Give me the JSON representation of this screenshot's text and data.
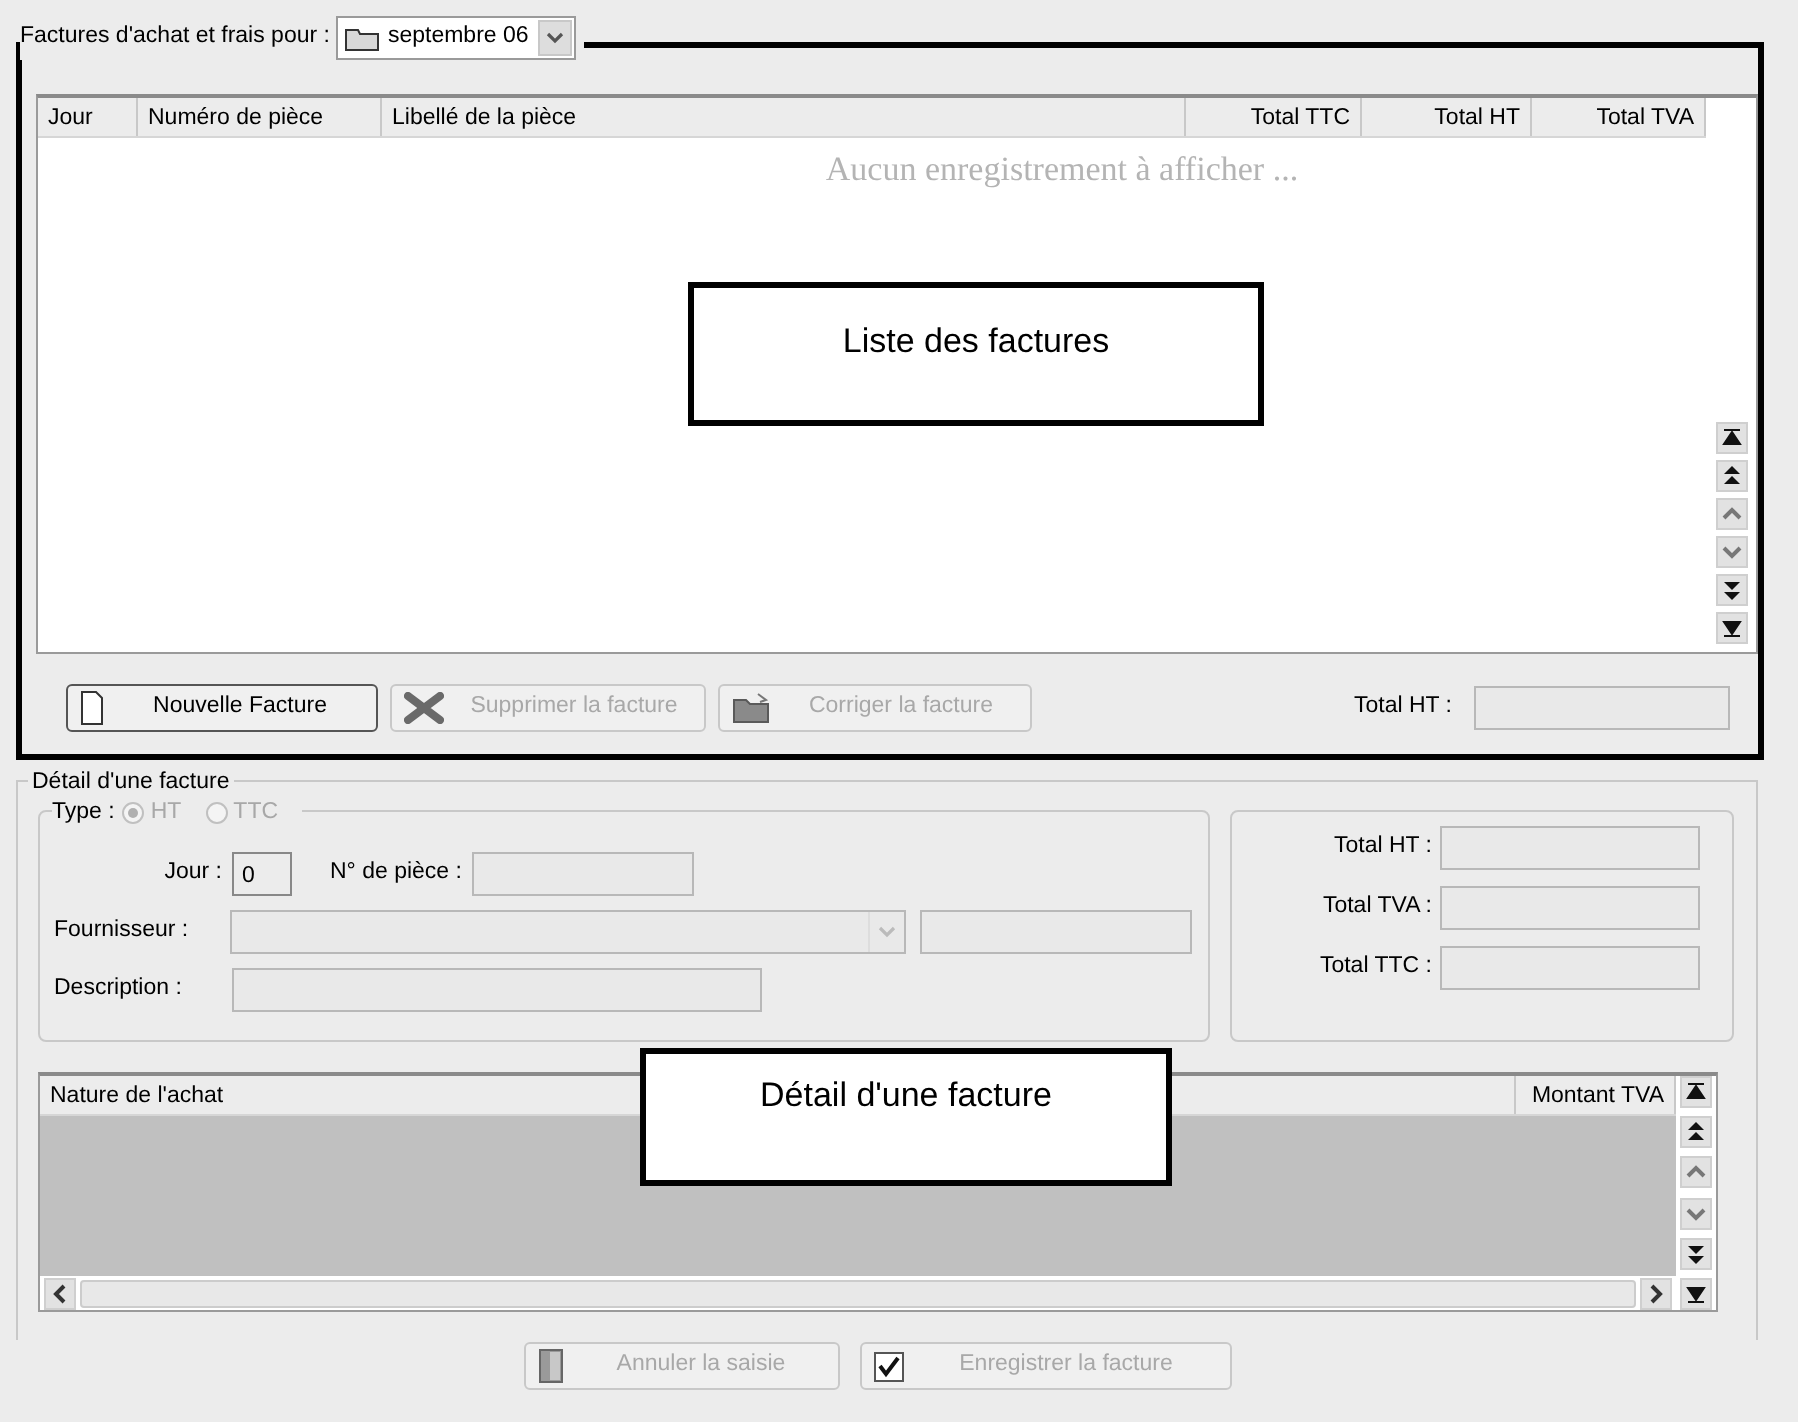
{
  "list_frame": {
    "legend": "Factures d'achat et frais pour :",
    "period": "septembre 06"
  },
  "invoice_list": {
    "columns": [
      {
        "label": "Jour"
      },
      {
        "label": "Numéro de pièce"
      },
      {
        "label": "Libellé de la pièce"
      },
      {
        "label": "Total TTC"
      },
      {
        "label": "Total HT"
      },
      {
        "label": "Total TVA"
      }
    ],
    "empty_message": "Aucun enregistrement à afficher ...",
    "callout": "Liste des factures"
  },
  "list_buttons": [
    {
      "label": "Nouvelle Facture",
      "kind": "new",
      "disabled": false
    },
    {
      "label": "Supprimer la facture",
      "kind": "delete",
      "disabled": true
    },
    {
      "label": "Corriger la facture",
      "kind": "edit",
      "disabled": true
    }
  ],
  "list_total": {
    "label": "Total HT :"
  },
  "detail": {
    "legend": "Détail d'une facture",
    "type_label": "Type :",
    "type_disabled": true,
    "type_options": [
      {
        "label": "HT",
        "selected": true
      },
      {
        "label": "TTC",
        "selected": false
      }
    ],
    "day": {
      "label": "Jour :",
      "value": "0"
    },
    "piece_number": {
      "label": "N° de pièce :"
    },
    "supplier": {
      "label": "Fournisseur :",
      "disabled": true
    },
    "description": {
      "label": "Description :"
    },
    "totals": [
      {
        "label": "Total HT :"
      },
      {
        "label": "Total TVA :"
      },
      {
        "label": "Total TTC :"
      }
    ]
  },
  "lines_grid": {
    "columns": [
      {
        "label": "Nature de l'achat"
      },
      {
        "label": "Montant TVA"
      }
    ],
    "callout": "Détail d'une facture"
  },
  "form_buttons": [
    {
      "label": "Annuler la saisie",
      "kind": "cancel",
      "disabled": true
    },
    {
      "label": "Enregistrer la facture",
      "kind": "save",
      "disabled": true
    }
  ]
}
